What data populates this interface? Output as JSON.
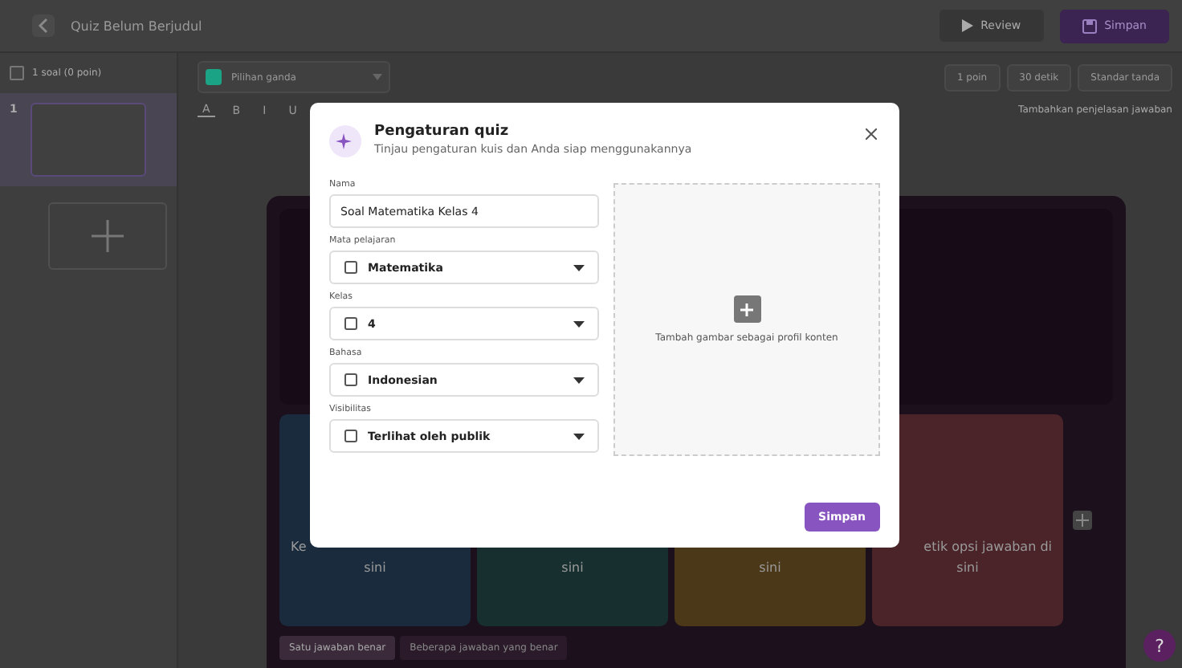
{
  "topbar": {
    "title": "Quiz Belum Berjudul",
    "review_button": "Review",
    "save_button": "Simpan"
  },
  "sidebar": {
    "select_all": {
      "label": "1 soal (0 poin)",
      "checked": false
    },
    "slides": [
      {
        "number": "1",
        "selected": true
      }
    ]
  },
  "editor": {
    "question_type": "Pilihan ganda",
    "format_buttons": [
      "A",
      "B",
      "I",
      "U"
    ],
    "settings": [
      "1 poin",
      "30 detik",
      "Standar tanda"
    ],
    "explanation_link": "Tambahkan penjelasan jawaban",
    "answers": [
      {
        "color": "#1a2b3d",
        "lines": [
          "Ke",
          "sini"
        ]
      },
      {
        "color": "#17302f",
        "lines": [
          "sini"
        ]
      },
      {
        "color": "#4a3818",
        "lines": [
          "sini"
        ]
      },
      {
        "color": "#4a2428",
        "lines": [
          "etik opsi jawaban di",
          "sini"
        ]
      }
    ],
    "answer_modes": [
      {
        "label": "Satu jawaban benar",
        "selected": true
      },
      {
        "label": "Beberapa jawaban yang benar",
        "selected": false
      }
    ]
  },
  "dialog": {
    "title": "Pengaturan quiz",
    "subtitle": "Tinjau pengaturan kuis dan Anda siap menggunakannya",
    "fields": [
      {
        "kind": "text",
        "label": "Nama",
        "value": "Soal Matematika Kelas 4"
      },
      {
        "kind": "select",
        "label": "Mata pelajaran",
        "value": "Matematika"
      },
      {
        "kind": "select",
        "label": "Kelas",
        "value": "4"
      },
      {
        "kind": "select",
        "label": "Bahasa",
        "value": "Indonesian"
      },
      {
        "kind": "select",
        "label": "Visibilitas",
        "value": "Terlihat oleh publik"
      }
    ],
    "image_drop": "Tambah gambar sebagai profil konten",
    "save_button": "Simpan"
  },
  "help_button": "?"
}
